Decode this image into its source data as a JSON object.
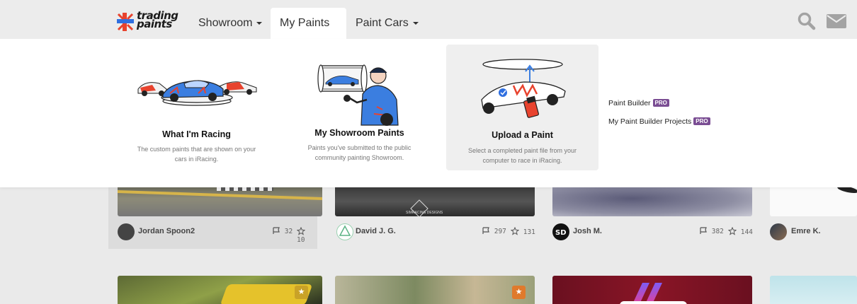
{
  "brand": {
    "logo_line1": "trading",
    "logo_line2": "paints",
    "accent_red": "#e8432e",
    "accent_blue": "#2f6fe0"
  },
  "nav": {
    "items": [
      {
        "label": "Showroom"
      },
      {
        "label": "My Paints"
      },
      {
        "label": "Paint Cars"
      }
    ],
    "search_icon": "search-icon",
    "mail_icon": "envelope-icon"
  },
  "dropdown": {
    "cards": [
      {
        "title": "What I'm Racing",
        "desc_line1": "The custom paints that are shown on your",
        "desc_line2": "cars in iRacing."
      },
      {
        "title": "My Showroom Paints",
        "desc_line1": "Paints you've submitted to the public",
        "desc_line2": "community painting Showroom."
      },
      {
        "title": "Upload a Paint",
        "desc_line1": "Select a completed paint file from your",
        "desc_line2": "computer to race in iRacing."
      }
    ],
    "links": [
      {
        "label": "Paint Builder",
        "badge": "PRO"
      },
      {
        "label": "My Paint Builder Projects",
        "badge": "PRO"
      }
    ]
  },
  "paints": [
    {
      "author": "Jordan Spoon2",
      "races": "32",
      "stars": "10"
    },
    {
      "author": "David J. G.",
      "races": "297",
      "stars": "131"
    },
    {
      "author": "Josh M.",
      "races": "382",
      "stars": "144"
    },
    {
      "author": "Emre K."
    }
  ],
  "thumb_watermark": "SIMRACING DESIGNS"
}
